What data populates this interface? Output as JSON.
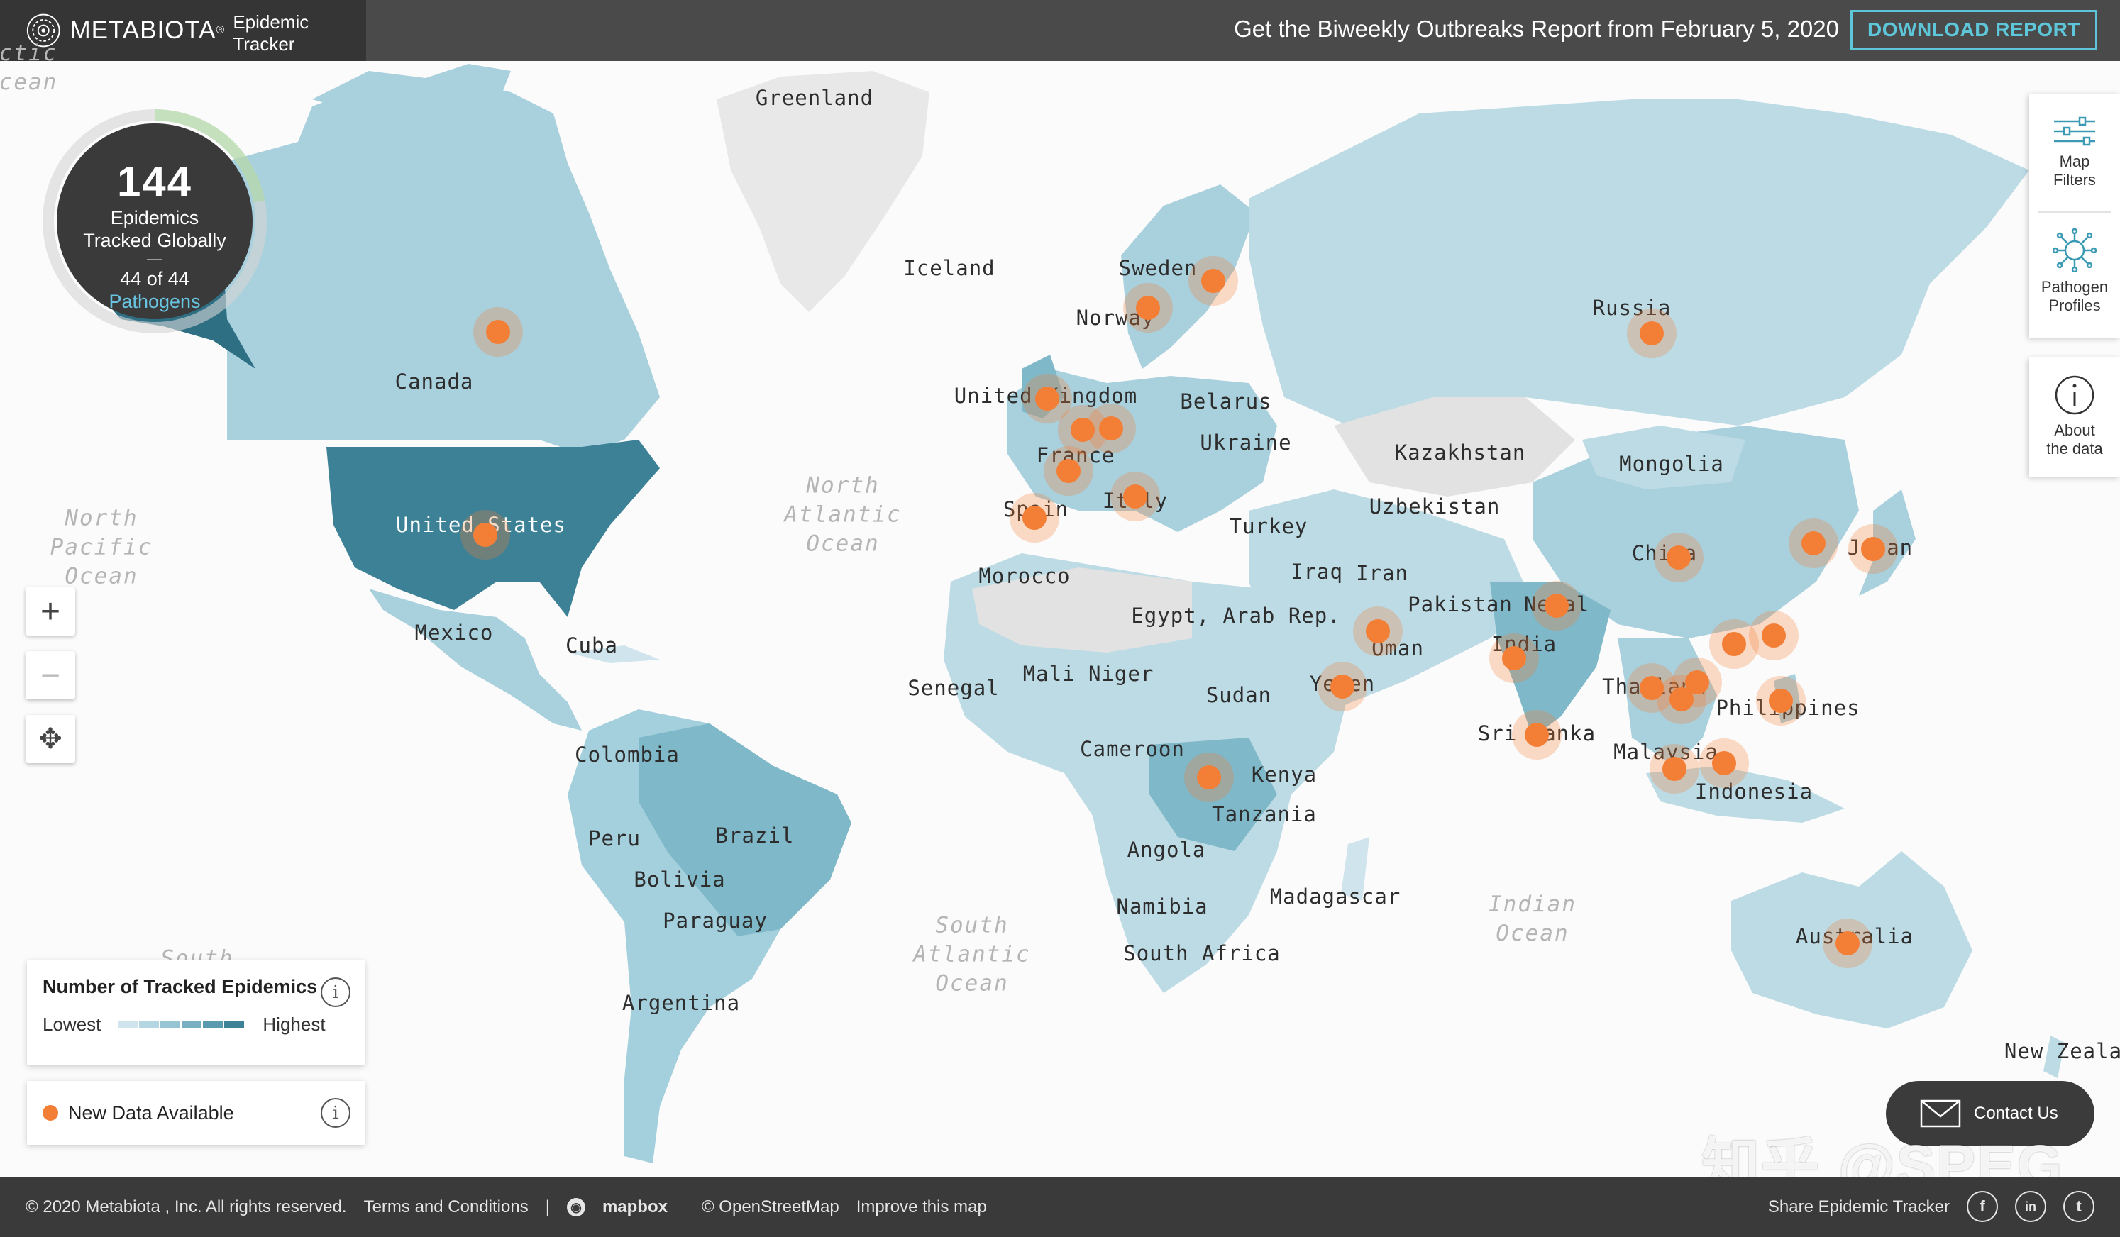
{
  "brand": {
    "name": "METABIOTA",
    "product": "Epidemic Tracker",
    "reg": "®"
  },
  "header": {
    "report_text": "Get the Biweekly Outbreaks Report from February 5, 2020",
    "download_label": "DOWNLOAD REPORT"
  },
  "counter": {
    "number": "144",
    "line1": "Epidemics",
    "line2": "Tracked Globally",
    "dash": "—",
    "pathogens_count": "44 of 44",
    "pathogens_label": "Pathogens",
    "progress_fraction": 1.0
  },
  "zoom": {
    "in": "+",
    "out": "−",
    "pan": "✥"
  },
  "legend": {
    "title": "Number of Tracked Epidemics",
    "low": "Lowest",
    "high": "Highest",
    "colors": [
      "#cfe4ec",
      "#b3d6e2",
      "#96c4d3",
      "#78b0c2",
      "#5a9aae",
      "#3e8297"
    ]
  },
  "new_data": {
    "label": "New Data Available",
    "color": "#f37f37"
  },
  "side": {
    "filters": "Map\nFilters",
    "profiles": "Pathogen\nProfiles",
    "about": "About\nthe data"
  },
  "contact": {
    "label": "Contact Us"
  },
  "watermark": "知乎 @SPEG",
  "map_labels": {
    "greenland": "Greenland",
    "iceland": "Iceland",
    "canada": "Canada",
    "united_states": "United States",
    "mexico": "Mexico",
    "cuba": "Cuba",
    "colombia": "Colombia",
    "peru": "Peru",
    "brazil": "Brazil",
    "bolivia": "Bolivia",
    "paraguay": "Paraguay",
    "argentina": "Argentina",
    "sweden": "Sweden",
    "norway": "Norway",
    "united_kingdom": "United Kingdom",
    "france": "France",
    "spain": "Spain",
    "italy": "Italy",
    "belarus": "Belarus",
    "ukraine": "Ukraine",
    "turkey": "Turkey",
    "russia": "Russia",
    "kazakhstan": "Kazakhstan",
    "uzbekistan": "Uzbekistan",
    "mongolia": "Mongolia",
    "china": "China",
    "japan": "Japan",
    "iraq": "Iraq",
    "iran": "Iran",
    "pakistan": "Pakistan",
    "nepal": "Nepal",
    "india": "India",
    "oman": "Oman",
    "yemen": "Yemen",
    "sri_lanka": "Sri Lanka",
    "thailand": "Thailand",
    "philippines": "Philippines",
    "malaysia": "Malaysia",
    "indonesia": "Indonesia",
    "australia": "Australia",
    "new_zealand": "New Zeala",
    "morocco": "Morocco",
    "egypt": "Egypt, Arab Rep.",
    "senegal": "Senegal",
    "mali_niger": "Mali Niger",
    "sudan": "Sudan",
    "cameroon": "Cameroon",
    "kenya": "Kenya",
    "tanzania": "Tanzania",
    "angola": "Angola",
    "namibia": "Namibia",
    "madagascar": "Madagascar",
    "south_africa": "South Africa"
  },
  "ocean_labels": {
    "north_pacific": "North\nPacific\nOcean",
    "north_atlantic": "North\nAtlantic\nOcean",
    "south_atlantic": "South\nAtlantic\nOcean",
    "indian": "Indian\nOcean",
    "south_edge": "South",
    "arctic_edge": "ctic\ncean"
  },
  "footer": {
    "copyright": "© 2020 Metabiota , Inc. All rights reserved.",
    "terms": "Terms and Conditions",
    "sep": "|",
    "mapbox": "mapbox",
    "osm": "© OpenStreetMap",
    "improve": "Improve this map",
    "share": "Share Epidemic Tracker",
    "social": [
      "f",
      "in",
      "t"
    ]
  }
}
